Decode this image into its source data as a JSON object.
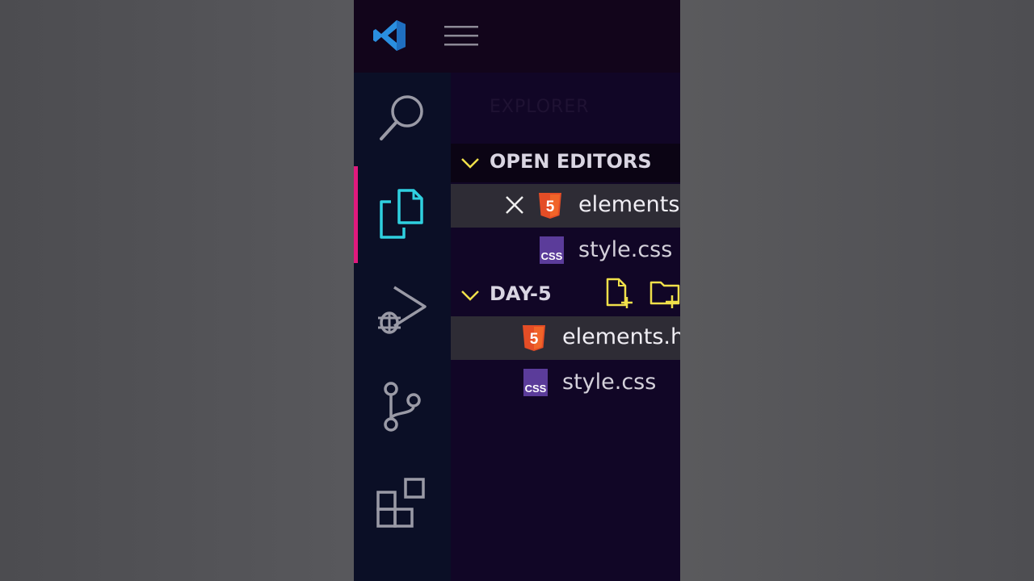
{
  "colors": {
    "accent_pink": "#e0197d",
    "explorer_icon_cyan": "#2fd0e0",
    "chevron_yellow": "#f0e04a",
    "html_orange": "#e44d26",
    "css_purple": "#5b3c9a",
    "activity_icon_gray": "#9a9aa6"
  },
  "titlebar": {
    "logo_icon": "vscode-logo-icon",
    "menu_icon": "hamburger-menu-icon"
  },
  "activity_bar": {
    "items": [
      {
        "icon": "search-icon",
        "active": false
      },
      {
        "icon": "explorer-files-icon",
        "active": true
      },
      {
        "icon": "run-debug-icon",
        "active": false
      },
      {
        "icon": "source-control-icon",
        "active": false
      },
      {
        "icon": "extensions-icon",
        "active": false
      }
    ]
  },
  "sidebar": {
    "title": "EXPLORER",
    "open_editors": {
      "label": "OPEN EDITORS",
      "items": [
        {
          "name": "elements.html",
          "icon": "html5-icon",
          "selected": true,
          "close_icon": "close-icon"
        },
        {
          "name": "style.css",
          "icon": "css-icon",
          "selected": false
        }
      ]
    },
    "folder": {
      "label": "DAY-5",
      "actions": [
        "new-file-icon",
        "new-folder-icon"
      ],
      "items": [
        {
          "name": "elements.html",
          "icon": "html5-icon",
          "selected": true
        },
        {
          "name": "style.css",
          "icon": "css-icon",
          "selected": false
        }
      ]
    }
  }
}
